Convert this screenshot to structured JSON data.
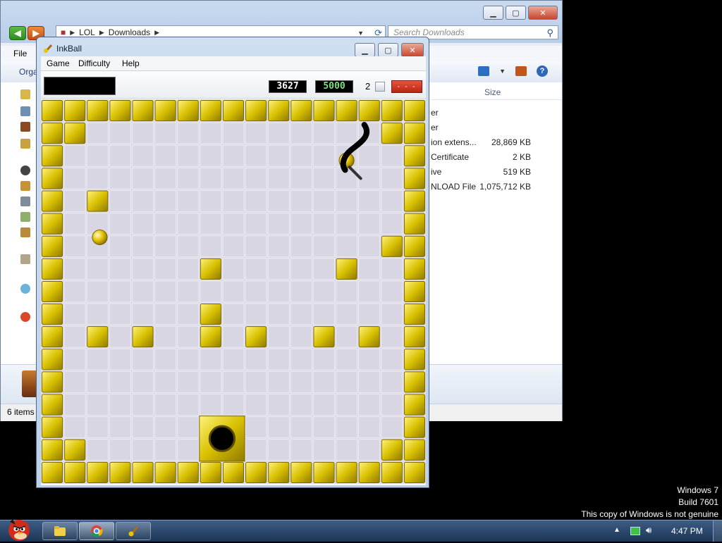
{
  "explorer": {
    "path": [
      "LOL",
      "Downloads"
    ],
    "search_placeholder": "Search Downloads",
    "menu_file": "File",
    "toolbar_organize": "Orga",
    "column_size": "Size",
    "files": [
      {
        "name": "er",
        "size": ""
      },
      {
        "name": "er",
        "size": ""
      },
      {
        "name": "ion extens...",
        "size": "28,869 KB"
      },
      {
        "name": "Certificate",
        "size": "2 KB"
      },
      {
        "name": "ive",
        "size": "519 KB"
      },
      {
        "name": "NLOAD File",
        "size": "1,075,712 KB"
      }
    ],
    "status": "6 items"
  },
  "inkball": {
    "title": "InkBall",
    "menu": [
      "Game",
      "Difficulty",
      "Help"
    ],
    "score": "3627",
    "max_score": "5000",
    "lives": "2",
    "timer": "- - -",
    "colors": {
      "wall": "#d8c000",
      "tile": "#d9d6e3",
      "ball": "#e6c400",
      "hole": "#000000"
    },
    "board": {
      "grid_size": 17,
      "walls": [
        [
          1,
          1
        ],
        [
          1,
          15
        ],
        [
          4,
          2
        ],
        [
          6,
          15
        ],
        [
          7,
          7
        ],
        [
          7,
          13
        ],
        [
          9,
          7
        ],
        [
          10,
          2
        ],
        [
          10,
          4
        ],
        [
          10,
          7
        ],
        [
          10,
          9
        ],
        [
          10,
          12
        ],
        [
          10,
          14
        ],
        [
          15,
          1
        ],
        [
          15,
          15
        ]
      ],
      "hole": {
        "row": 14,
        "col": 7
      },
      "balls": [
        {
          "row": 6.1,
          "col": 2.6
        },
        {
          "row": 2.7,
          "col": 13.5
        }
      ]
    }
  },
  "desktop": {
    "watermark": [
      "Windows 7",
      "Build 7601",
      "This copy of Windows is not genuine"
    ],
    "clock": "4:47 PM"
  },
  "taskbar": {
    "buttons": [
      "explorer-button",
      "chrome-button",
      "inkball-button"
    ]
  }
}
